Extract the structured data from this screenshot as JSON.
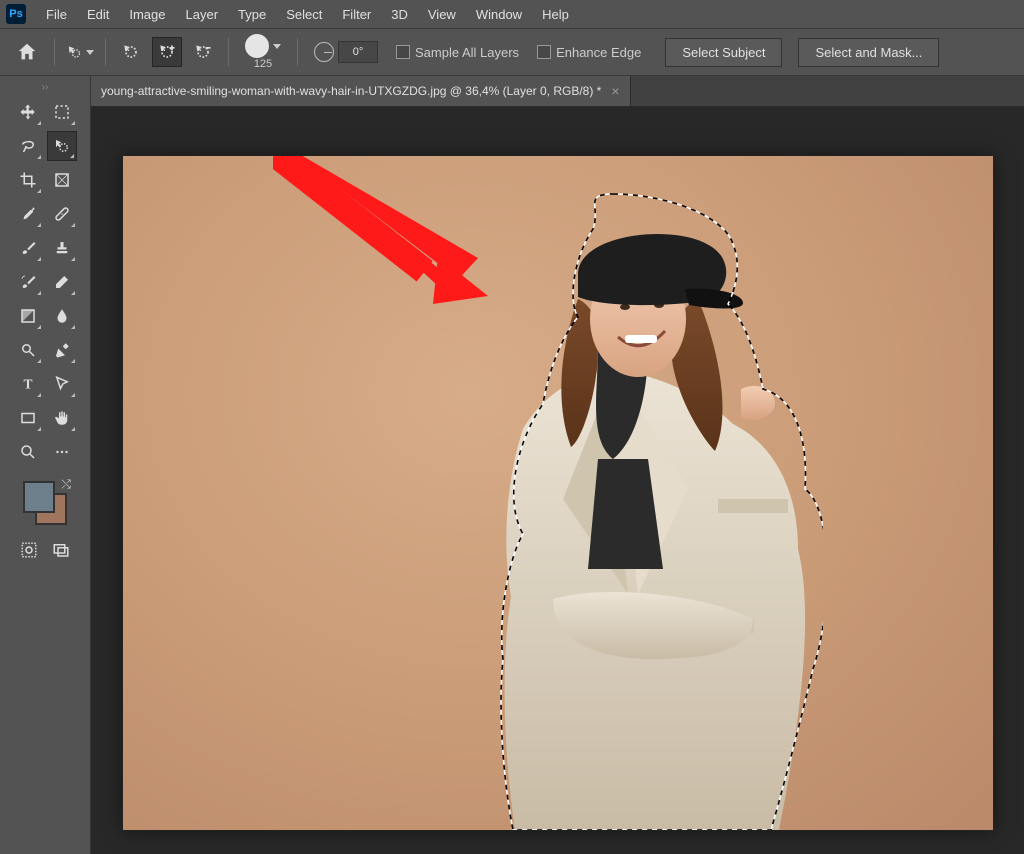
{
  "app": {
    "logo_text": "Ps"
  },
  "menu": {
    "items": [
      "File",
      "Edit",
      "Image",
      "Layer",
      "Type",
      "Select",
      "Filter",
      "3D",
      "View",
      "Window",
      "Help"
    ]
  },
  "options": {
    "brush_size": "125",
    "angle": "0°",
    "sample_all_layers": "Sample All Layers",
    "enhance_edge": "Enhance Edge",
    "select_subject": "Select Subject",
    "select_and_mask": "Select and Mask..."
  },
  "document": {
    "tab_title": "young-attractive-smiling-woman-with-wavy-hair-in-UTXGZDG.jpg @ 36,4% (Layer 0, RGB/8) *"
  },
  "tools": {
    "items": [
      {
        "name": "move-tool"
      },
      {
        "name": "marquee-tool"
      },
      {
        "name": "lasso-tool"
      },
      {
        "name": "quick-selection-tool",
        "selected": true
      },
      {
        "name": "crop-tool"
      },
      {
        "name": "frame-tool"
      },
      {
        "name": "eyedropper-tool"
      },
      {
        "name": "healing-brush-tool"
      },
      {
        "name": "brush-tool"
      },
      {
        "name": "clone-stamp-tool"
      },
      {
        "name": "history-brush-tool"
      },
      {
        "name": "eraser-tool"
      },
      {
        "name": "gradient-tool"
      },
      {
        "name": "blur-tool"
      },
      {
        "name": "dodge-tool"
      },
      {
        "name": "pen-tool"
      },
      {
        "name": "type-tool"
      },
      {
        "name": "path-selection-tool"
      },
      {
        "name": "rectangle-tool"
      },
      {
        "name": "hand-tool"
      },
      {
        "name": "zoom-tool"
      },
      {
        "name": "spacer"
      }
    ],
    "swatches": {
      "fg": "#6D7F8A",
      "bg": "#A0755E"
    }
  }
}
